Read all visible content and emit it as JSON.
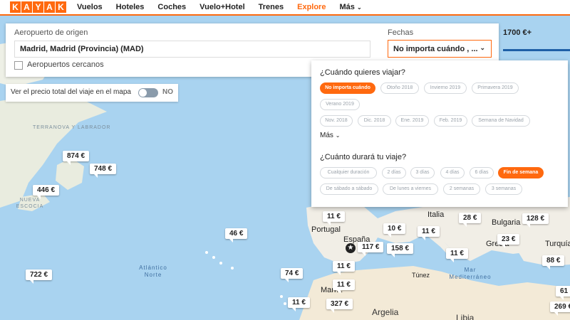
{
  "nav": {
    "logo_letters": [
      "K",
      "A",
      "Y",
      "A",
      "K"
    ],
    "items": [
      "Vuelos",
      "Hoteles",
      "Coches",
      "Vuelo+Hotel",
      "Trenes",
      "Explore",
      "Más"
    ],
    "active": "Explore",
    "accent": "#ff690f"
  },
  "search": {
    "origin_label": "Aeropuerto de origen",
    "origin_value": "Madrid, Madrid (Provincia) (MAD)",
    "nearby_label": "Aeropuertos cercanos",
    "dates_label": "Fechas",
    "dates_value": "No importa cuándo , ...",
    "price_value": "1700 €+"
  },
  "toggle": {
    "label": "Ver el precio total del viaje en el mapa",
    "state": "NO"
  },
  "dropdown": {
    "when_title": "¿Cuándo quieres viajar?",
    "when_options": [
      "No importa cuándo",
      "Otoño 2018",
      "Invierno 2019",
      "Primavera 2019",
      "Verano 2019",
      "Nov. 2018",
      "Dic. 2018",
      "Ene. 2019",
      "Feb. 2019",
      "Semana de Navidad"
    ],
    "when_selected": "No importa cuándo",
    "more_label": "Más",
    "duration_title": "¿Cuánto durará tu viaje?",
    "duration_options": [
      "Cualquier duración",
      "2 días",
      "3 días",
      "4 días",
      "6 días",
      "Fin de semana",
      "De sábado a sábado",
      "De lunes a viernes",
      "2 semanas",
      "3 semanas"
    ],
    "duration_selected": "Fin de semana"
  },
  "map": {
    "prices": [
      "874 €",
      "748 €",
      "446 €",
      "722 €",
      "46 €",
      "74 €",
      "11 €",
      "327 €",
      "11 €",
      "11 €",
      "117 €",
      "158 €",
      "10 €",
      "11 €",
      "11 €",
      "28 €",
      "128 €",
      "23 €",
      "88 €",
      "61 €",
      "269 €",
      "11 €"
    ],
    "country_labels": [
      "Portugal",
      "España",
      "Italia",
      "Grecia",
      "Bulgaria",
      "Turquía",
      "Argelia",
      "Libia",
      "Túnez"
    ],
    "ocean_labels": [
      "Atlántico Norte",
      "Mar Mediterráneo"
    ],
    "land_labels": [
      "TERRANOVA Y LABRADOR",
      "NUEVA ESCOCIA"
    ],
    "other_labels": [
      "Marr..."
    ]
  }
}
